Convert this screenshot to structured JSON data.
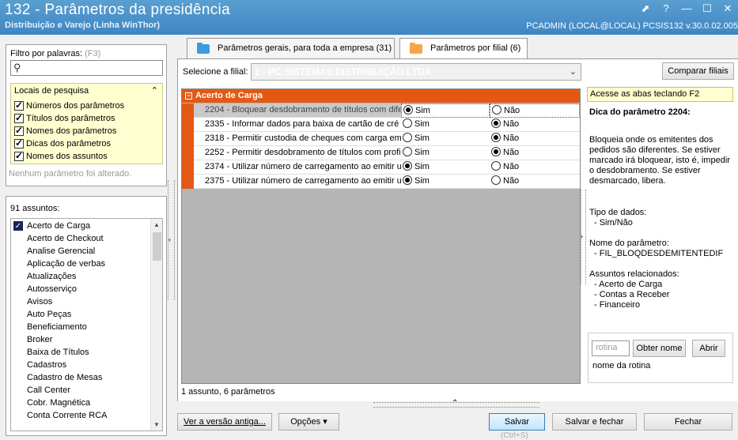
{
  "window": {
    "title": "132 - Parâmetros da presidência",
    "subtitle": "Distribuição e Varejo (Linha WinThor)",
    "user_info": "PCADMIN (LOCAL@LOCAL)   PCSIS132  v.30.0.02.005",
    "buttons": [
      "⬈",
      "?",
      "—",
      "☐",
      "✕"
    ]
  },
  "filter": {
    "label": "Filtro por palavras:",
    "shortcut": "(F3)",
    "search_value": "",
    "locais_title": "Locais de pesquisa",
    "locais": [
      {
        "label": "Números dos parâmetros",
        "checked": true
      },
      {
        "label": "Títulos dos parâmetros",
        "checked": true
      },
      {
        "label": "Nomes dos parâmetros",
        "checked": true
      },
      {
        "label": "Dicas dos parâmetros",
        "checked": true
      },
      {
        "label": "Nomes dos assuntos",
        "checked": true
      }
    ],
    "status": "Nenhum parâmetro foi alterado."
  },
  "assuntos": {
    "count_label": "91 assuntos:",
    "items": [
      "Acerto de Carga",
      "Acerto de Checkout",
      "Analise Gerencial",
      "Aplicação de verbas",
      "Atualizações",
      "Autosserviço",
      "Avisos",
      "Auto Peças",
      "Beneficiamento",
      "Broker",
      "Baixa de Títulos",
      "Cadastros",
      "Cadastro de Mesas",
      "Call Center",
      "Cobr. Magnética",
      "Conta Corrente RCA"
    ],
    "selected": "Acerto de Carga"
  },
  "tabs": [
    {
      "label": "Parâmetros gerais, para toda a empresa",
      "count": "(31)",
      "color": "#3a9be0",
      "active": false
    },
    {
      "label": "Parâmetros por filial",
      "count": "(6)",
      "color": "#f5a54a",
      "active": true
    }
  ],
  "filial": {
    "label": "Selecione a filial:",
    "value": "1 - PC SISTEMAS DISTRIBUIÇÃO LTDA",
    "compare_button": "Comparar filiais"
  },
  "grid": {
    "group": "Acerto de Carga",
    "yes_label": "Sim",
    "no_label": "Não",
    "rows": [
      {
        "label": "2204 - Bloquear desdobramento de títulos com dife",
        "value": "Sim",
        "selected": true
      },
      {
        "label": "2335 - Informar dados para baixa de cartão de cré",
        "value": "Não",
        "selected": false
      },
      {
        "label": "2318 - Permitir custodia de cheques com carga em a",
        "value": "Não",
        "selected": false
      },
      {
        "label": "2252 - Permitir desdobramento de títulos com profis",
        "value": "Não",
        "selected": false
      },
      {
        "label": "2374 - Utilizar número de carregamento ao emitir ur",
        "value": "Sim",
        "selected": false
      },
      {
        "label": "2375 - Utilizar número de carregamento ao emitir ur",
        "value": "Sim",
        "selected": false
      }
    ],
    "status": "1 assunto, 6 parâmetros"
  },
  "tip": {
    "hint": "Acesse as abas teclando F2",
    "title": "Dica do parâmetro 2204:",
    "body": "Bloqueia onde os emitentes dos pedidos são diferentes. Se estiver marcado irá bloquear, isto é, impedir o desdobramento. Se estiver desmarcado, libera.",
    "tipo_title": "Tipo de dados:",
    "tipo_value": "- Sim/Não",
    "nome_title": "Nome do parâmetro:",
    "nome_value": "- FIL_BLOQDESDEMITENTEDIF",
    "assuntos_title": "Assuntos relacionados:",
    "assuntos": [
      "- Acerto de Carga",
      "- Contas a Receber",
      "- Financeiro"
    ]
  },
  "rotina": {
    "placeholder": "rotina",
    "get_name_button": "Obter nome",
    "open_button": "Abrir",
    "name_label": "nome da rotina"
  },
  "footer": {
    "old_version_button": "Ver a versão antiga...",
    "options_button": "Opções",
    "save_button": "Salvar",
    "save_shortcut": "(Ctrl+S)",
    "save_close_button": "Salvar e fechar",
    "close_button": "Fechar"
  }
}
